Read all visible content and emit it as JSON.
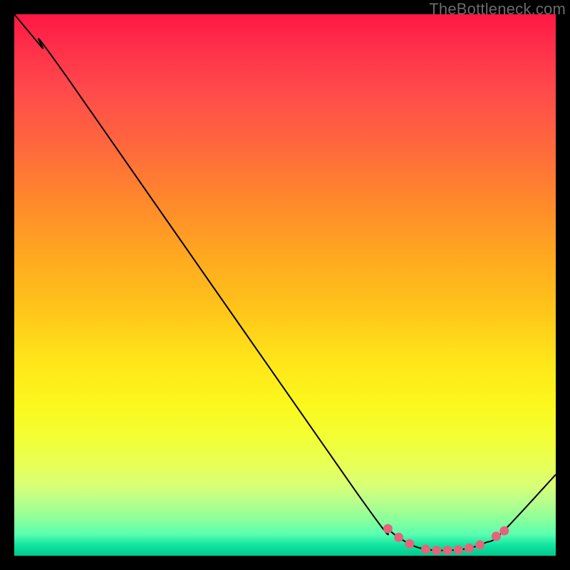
{
  "watermark": "TheBottleneck.com",
  "chart_data": {
    "type": "line",
    "title": "",
    "xlabel": "",
    "ylabel": "",
    "xlim": [
      0,
      100
    ],
    "ylim": [
      0,
      100
    ],
    "curve": [
      {
        "x": 0,
        "y": 100
      },
      {
        "x": 5,
        "y": 94
      },
      {
        "x": 10,
        "y": 88
      },
      {
        "x": 63,
        "y": 12
      },
      {
        "x": 69,
        "y": 5
      },
      {
        "x": 73,
        "y": 2.2
      },
      {
        "x": 76,
        "y": 1.2
      },
      {
        "x": 80,
        "y": 1.0
      },
      {
        "x": 84,
        "y": 1.4
      },
      {
        "x": 87,
        "y": 2.4
      },
      {
        "x": 90,
        "y": 4.2
      },
      {
        "x": 100,
        "y": 15
      }
    ],
    "highlight_points": [
      {
        "x": 69,
        "y": 5.0
      },
      {
        "x": 71,
        "y": 3.4
      },
      {
        "x": 73,
        "y": 2.2
      },
      {
        "x": 76,
        "y": 1.2
      },
      {
        "x": 78,
        "y": 1.0
      },
      {
        "x": 80,
        "y": 1.0
      },
      {
        "x": 82,
        "y": 1.1
      },
      {
        "x": 84,
        "y": 1.4
      },
      {
        "x": 86,
        "y": 2.0
      },
      {
        "x": 89,
        "y": 3.6
      },
      {
        "x": 90.5,
        "y": 4.6
      }
    ],
    "colors": {
      "curve": "#000000",
      "points": "#e7637b",
      "gradient_top": "#ff1744",
      "gradient_bottom": "#00c98c"
    }
  }
}
